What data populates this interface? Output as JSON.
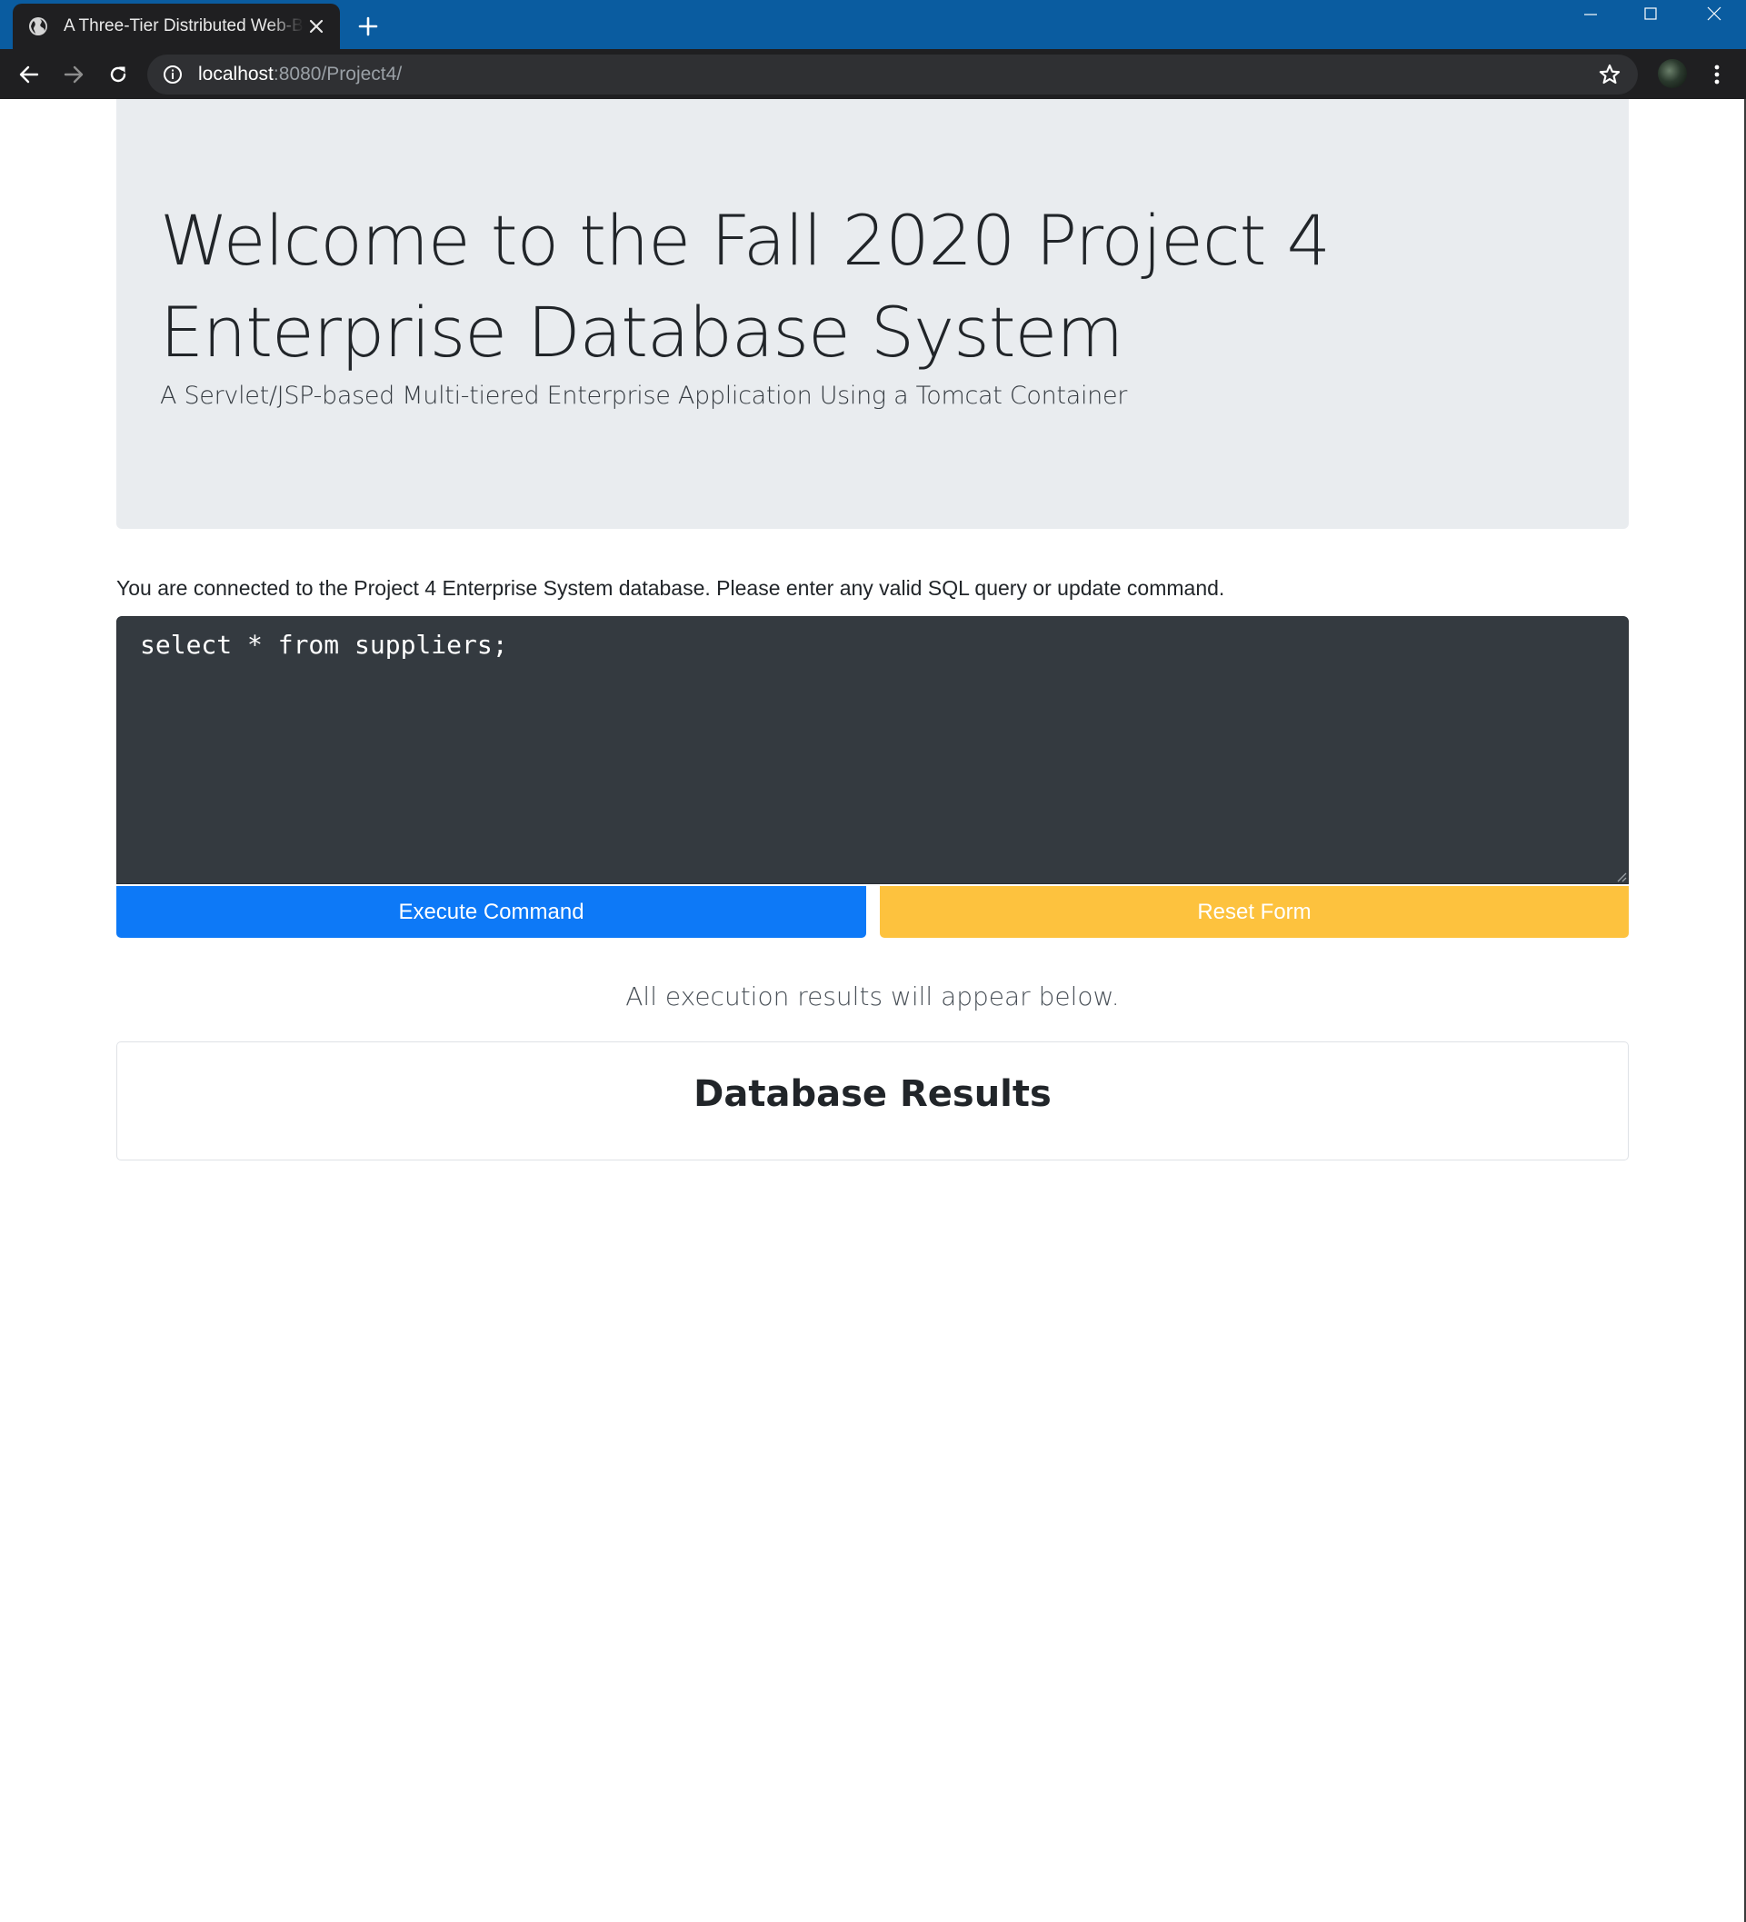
{
  "browser": {
    "tab_title": "A Three-Tier Distributed Web-Based Application",
    "url_host": "localhost",
    "url_rest": ":8080/Project4/"
  },
  "icons": {
    "favicon": "globe-icon",
    "tab_close": "close-icon",
    "new_tab": "plus-icon",
    "back": "arrow-left-icon",
    "forward": "arrow-right-icon",
    "reload": "reload-icon",
    "site_info": "info-icon",
    "bookmark": "star-icon",
    "menu": "kebab-menu-icon"
  },
  "jumbotron": {
    "title_line1": "Welcome to the Fall 2020 Project 4",
    "title_line2": "Enterprise Database System",
    "subtitle": "A Servlet/JSP-based Multi-tiered Enterprise Application Using a Tomcat Container"
  },
  "form": {
    "intro_text": "You are connected to the Project 4 Enterprise System database. Please enter any valid SQL query or update command.",
    "sql_value": "select * from suppliers;",
    "execute_label": "Execute Command",
    "reset_label": "Reset Form"
  },
  "results": {
    "note": "All execution results will appear below.",
    "heading": "Database Results"
  },
  "colors": {
    "titlebar": "#0a5ca0",
    "toolbar": "#1f1f21",
    "jumbotron_bg": "#e9ecef",
    "textarea_bg": "#343a40",
    "primary": "#0d79f7",
    "warning": "#fdc23e"
  }
}
